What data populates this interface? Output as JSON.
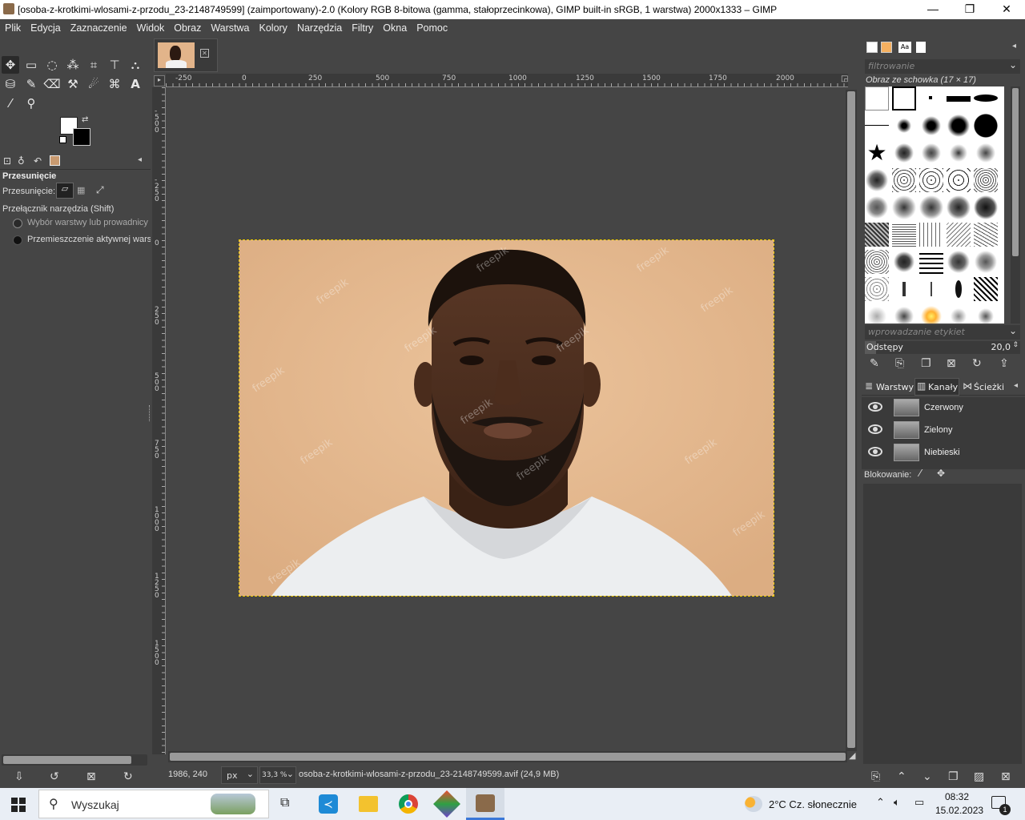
{
  "window": {
    "title": "[osoba-z-krotkimi-wlosami-z-przodu_23-2148749599] (zaimportowany)-2.0 (Kolory RGB 8-bitowa (gamma, stałoprzecinkowa), GIMP built-in sRGB, 1 warstwa) 2000x1333 – GIMP",
    "minimize": "—",
    "maximize": "❐",
    "close": "✕"
  },
  "menu": [
    "Plik",
    "Edycja",
    "Zaznaczenie",
    "Widok",
    "Obraz",
    "Warstwa",
    "Kolory",
    "Narzędzia",
    "Filtry",
    "Okna",
    "Pomoc"
  ],
  "tool_options": {
    "heading": "Przesunięcie",
    "move_label": "Przesunięcie:",
    "switch_label": "Przełącznik narzędzia  (Shift)",
    "option1": "Wybór warstwy lub prowadnicy",
    "option2": "Przemieszczenie aktywnej warstwy"
  },
  "ruler": {
    "h_ticks": [
      "-250",
      "0",
      "250",
      "500",
      "750",
      "1000",
      "1250",
      "1500",
      "1750",
      "2000"
    ],
    "v_ticks": [
      "-500",
      "-250",
      "0",
      "250",
      "500",
      "750",
      "1000",
      "1250",
      "1500"
    ]
  },
  "status": {
    "coords": "1986, 240",
    "unit": "px",
    "zoom": "33,3 %",
    "file": "osoba-z-krotkimi-wlosami-z-przodu_23-2148749599.avif (24,9 MB)"
  },
  "brushes": {
    "filter_placeholder": "filtrowanie",
    "selected_name": "Obraz ze schowka (17 × 17)",
    "tag_placeholder": "wprowadzanie etykiet",
    "spacing_label": "Odstępy",
    "spacing_value": "20,0"
  },
  "dock_tabs": {
    "layers": "Warstwy",
    "channels": "Kanały",
    "paths": "Ścieżki"
  },
  "channels": [
    "Czerwony",
    "Zielony",
    "Niebieski"
  ],
  "lock_label": "Blokowanie:",
  "watermark": "freepik",
  "taskbar": {
    "search": "Wyszukaj",
    "weather": "2°C  Cz. słonecznie",
    "time": "08:32",
    "date": "15.02.2023",
    "notification_count": "1"
  },
  "colors": {
    "background": "#454545",
    "photo_bg": "#e2b48a",
    "selection": "#f5d000"
  }
}
